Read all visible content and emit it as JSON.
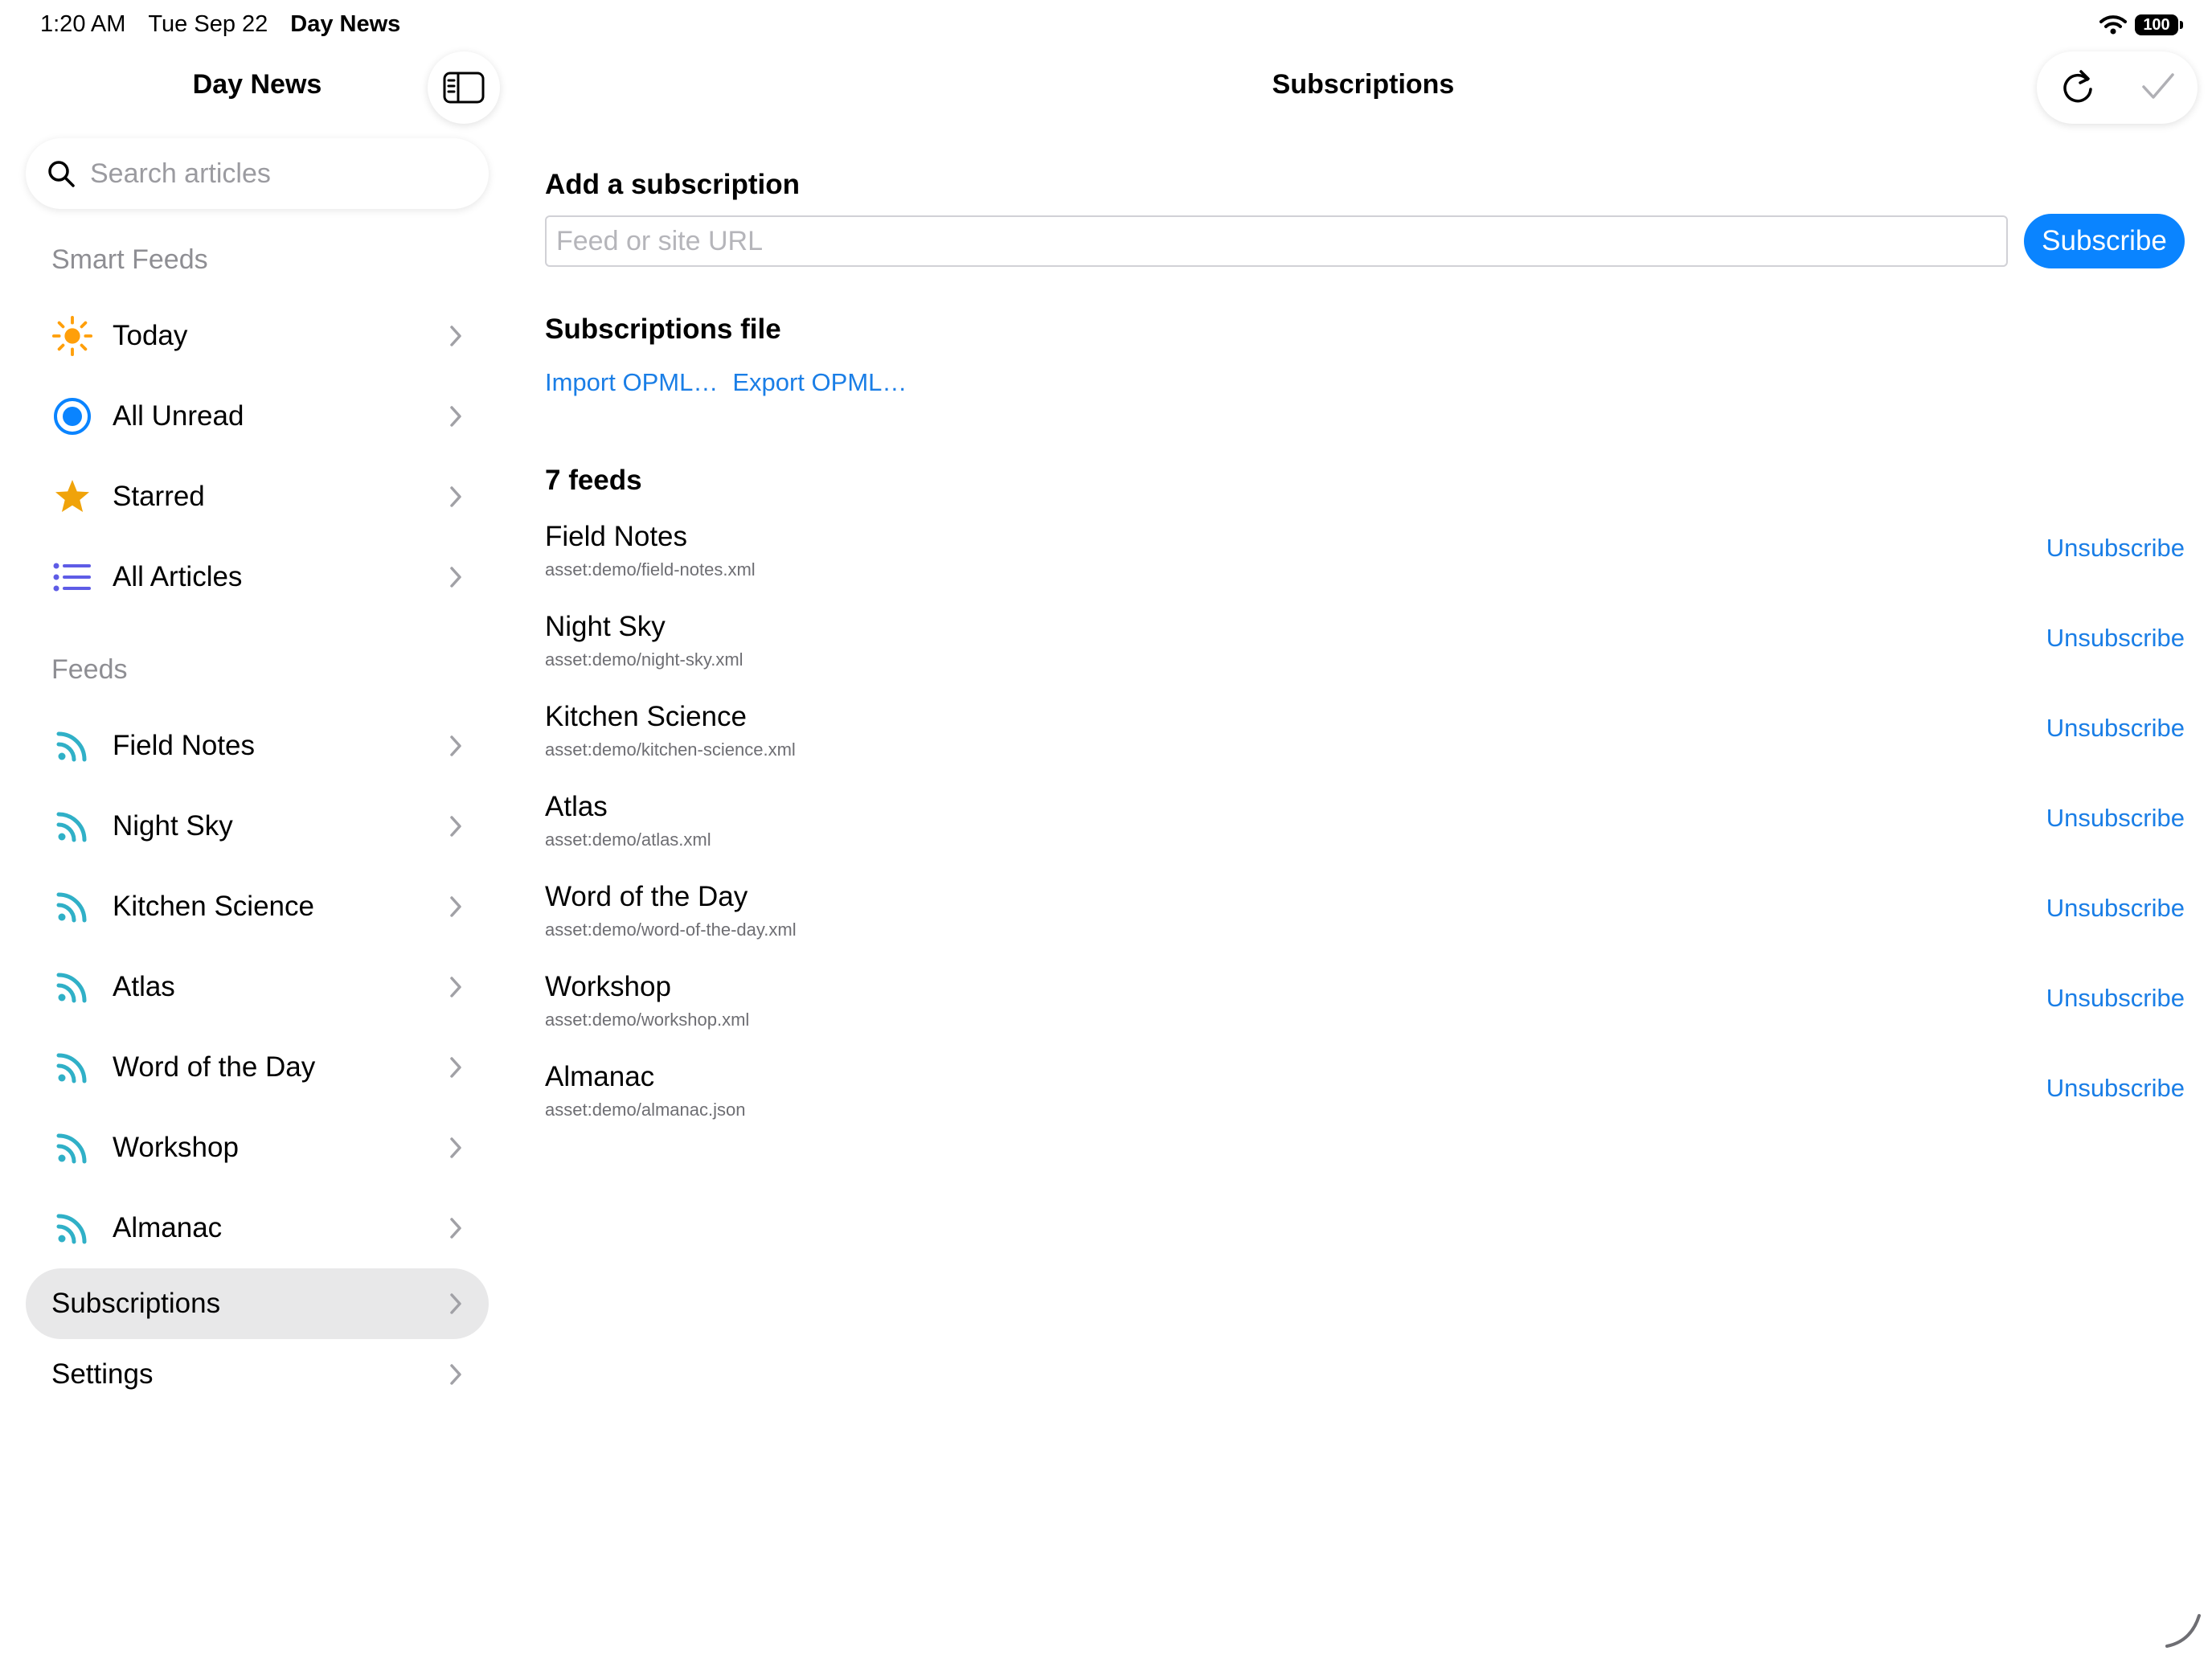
{
  "status_bar": {
    "time": "1:20 AM",
    "date": "Tue Sep 22",
    "app": "Day News",
    "battery": "100"
  },
  "sidebar": {
    "title": "Day News",
    "search_placeholder": "Search articles",
    "smart_feeds_header": "Smart Feeds",
    "smart_feeds": [
      {
        "label": "Today",
        "icon": "sun-icon"
      },
      {
        "label": "All Unread",
        "icon": "unread-circle-icon"
      },
      {
        "label": "Starred",
        "icon": "star-icon"
      },
      {
        "label": "All Articles",
        "icon": "list-icon"
      }
    ],
    "feeds_header": "Feeds",
    "feeds": [
      {
        "label": "Field Notes"
      },
      {
        "label": "Night Sky"
      },
      {
        "label": "Kitchen Science"
      },
      {
        "label": "Atlas"
      },
      {
        "label": "Word of the Day"
      },
      {
        "label": "Workshop"
      },
      {
        "label": "Almanac"
      }
    ],
    "subscriptions_label": "Subscriptions",
    "settings_label": "Settings"
  },
  "main": {
    "title": "Subscriptions",
    "add_header": "Add a subscription",
    "url_placeholder": "Feed or site URL",
    "subscribe_label": "Subscribe",
    "file_header": "Subscriptions file",
    "import_label": "Import OPML…",
    "export_label": "Export OPML…",
    "feeds_count": "7 feeds",
    "unsubscribe_label": "Unsubscribe",
    "feeds": [
      {
        "name": "Field Notes",
        "url": "asset:demo/field-notes.xml"
      },
      {
        "name": "Night Sky",
        "url": "asset:demo/night-sky.xml"
      },
      {
        "name": "Kitchen Science",
        "url": "asset:demo/kitchen-science.xml"
      },
      {
        "name": "Atlas",
        "url": "asset:demo/atlas.xml"
      },
      {
        "name": "Word of the Day",
        "url": "asset:demo/word-of-the-day.xml"
      },
      {
        "name": "Workshop",
        "url": "asset:demo/workshop.xml"
      },
      {
        "name": "Almanac",
        "url": "asset:demo/almanac.json"
      }
    ]
  },
  "colors": {
    "accent": "#0a84ff",
    "link": "#1a7ee6",
    "feed_icon": "#30b0c7",
    "sun": "#ff9f0a",
    "star": "#f0a30a",
    "list": "#5e5ce6",
    "selected_row": "#e8e8e9"
  }
}
